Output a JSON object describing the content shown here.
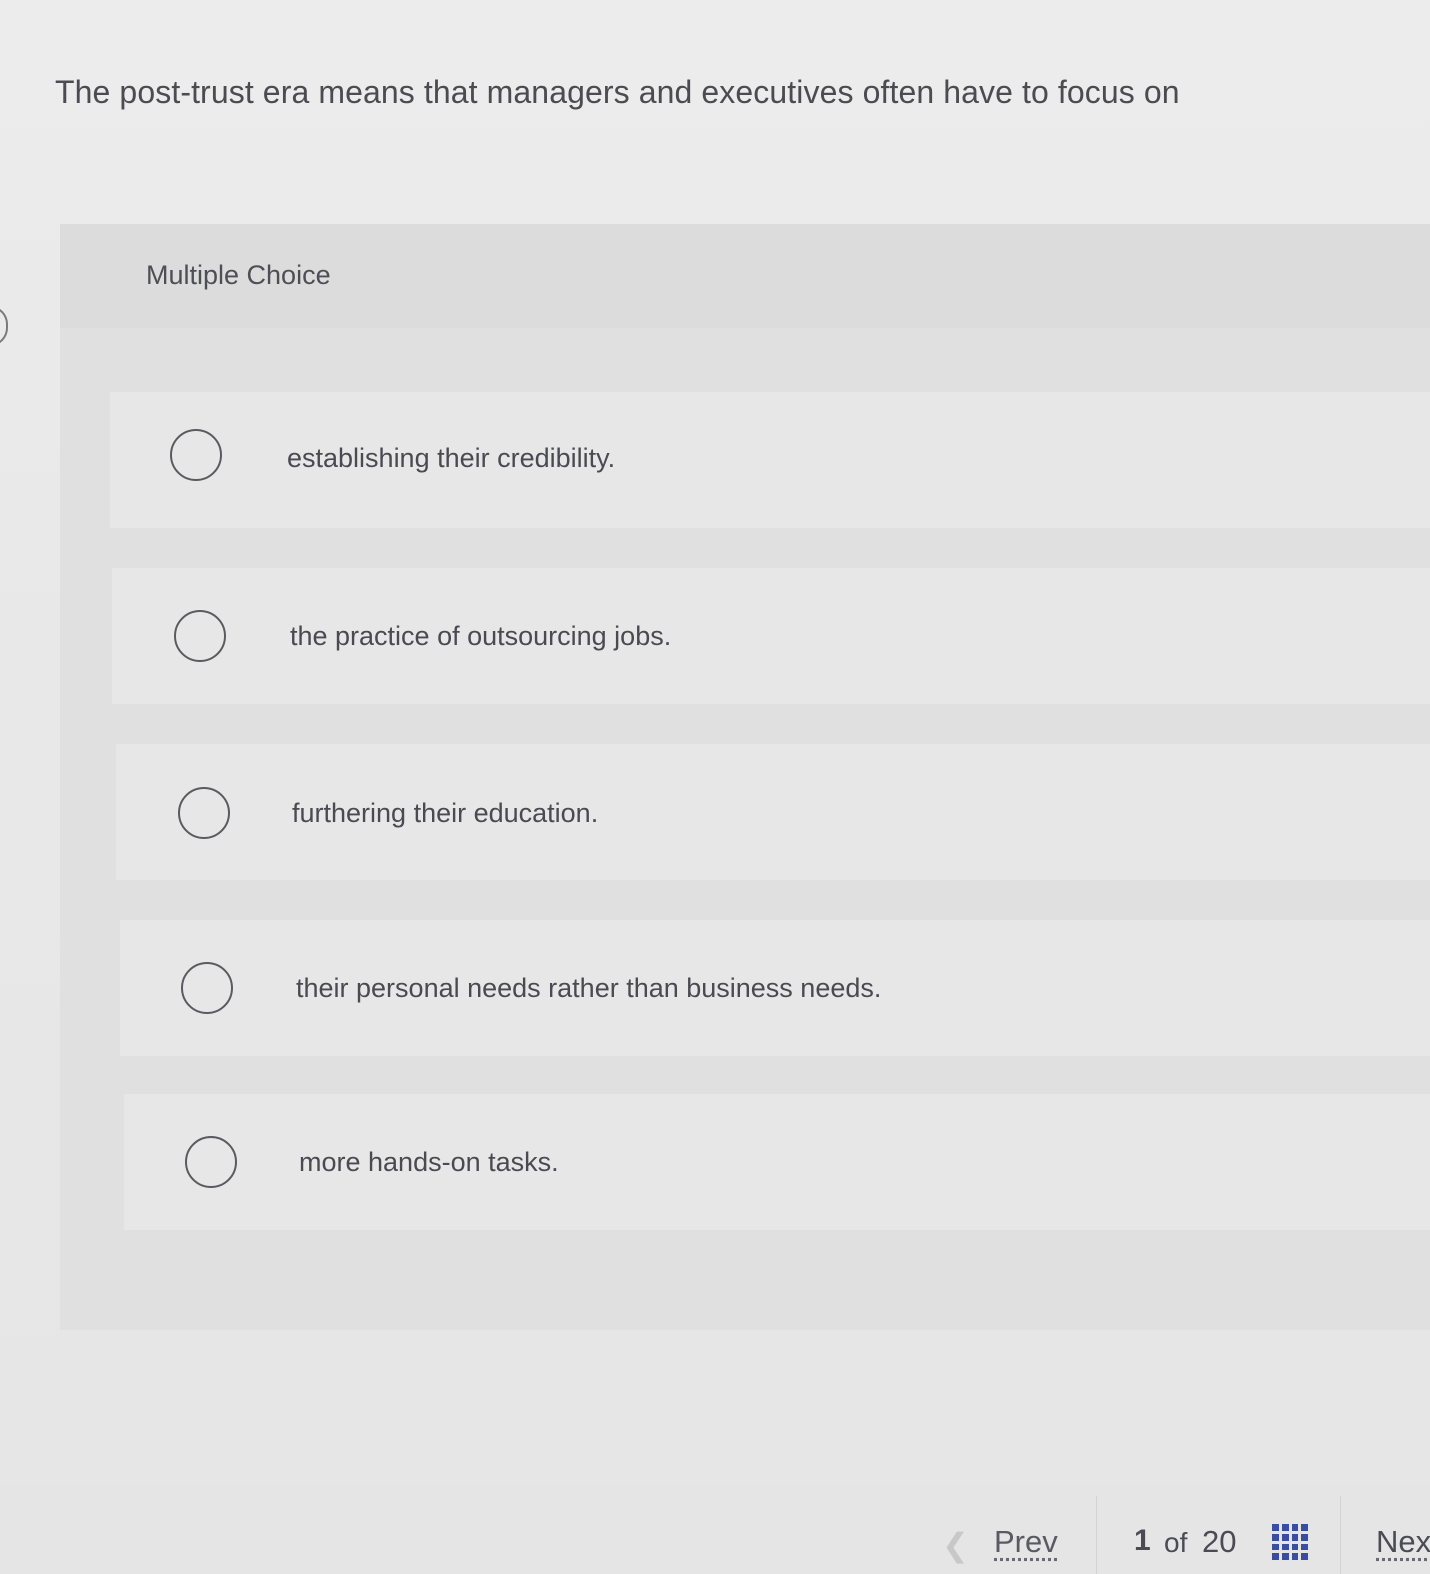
{
  "question": {
    "text": "The post-trust era means that managers and executives often have to focus on"
  },
  "question_type": {
    "label": "Multiple Choice"
  },
  "options": [
    {
      "label": "establishing their credibility."
    },
    {
      "label": "the practice of outsourcing jobs."
    },
    {
      "label": "furthering their education."
    },
    {
      "label": "their personal needs rather than business needs."
    },
    {
      "label": "more hands-on tasks."
    }
  ],
  "pagination": {
    "prev_label": "Prev",
    "current": "1",
    "of_label": "of",
    "total": "20",
    "next_label": "Nex",
    "prev_icon": "chevron-left-icon",
    "grid_icon": "question-grid-icon"
  },
  "colors": {
    "background": "#e9e9e9",
    "text": "#4a4a52",
    "grid_icon": "#3a4ea0"
  }
}
